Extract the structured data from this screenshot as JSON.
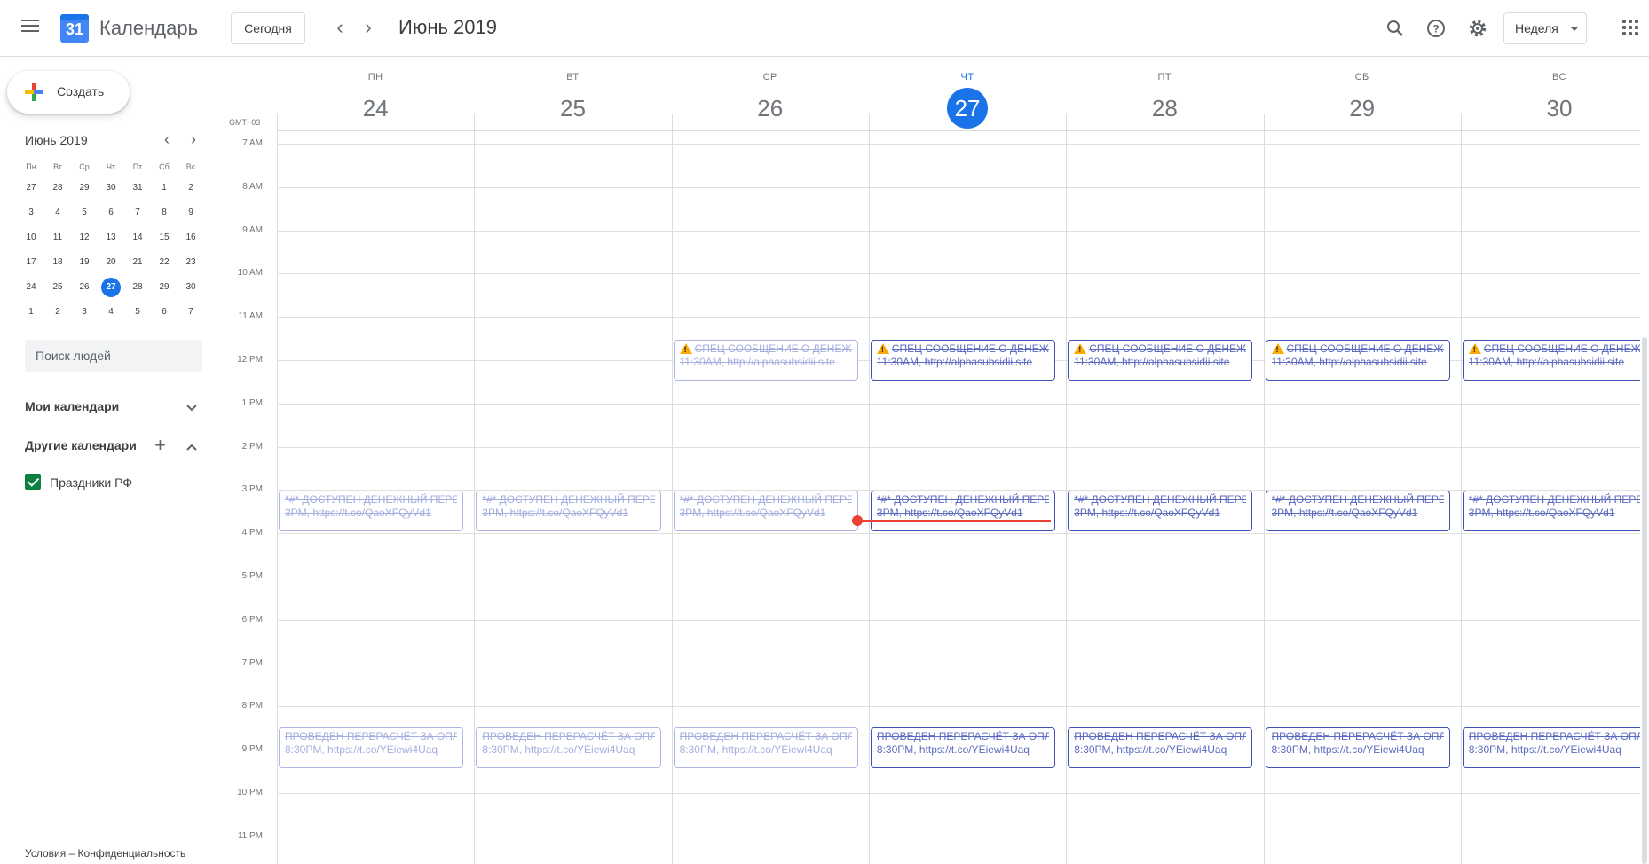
{
  "header": {
    "app_name": "Календарь",
    "logo_number": "31",
    "today_button": "Сегодня",
    "month_title": "Июнь 2019",
    "view_select": "Неделя",
    "icons": [
      "menu-icon",
      "chevron-left-icon",
      "chevron-right-icon",
      "search-icon",
      "help-icon",
      "settings-icon",
      "apps-icon"
    ]
  },
  "sidebar": {
    "create_label": "Создать",
    "mini_calendar": {
      "title": "Июнь 2019",
      "weekdays": [
        "Пн",
        "Вт",
        "Ср",
        "Чт",
        "Пт",
        "Сб",
        "Вс"
      ],
      "weeks": [
        [
          "27",
          "28",
          "29",
          "30",
          "31",
          "1",
          "2"
        ],
        [
          "3",
          "4",
          "5",
          "6",
          "7",
          "8",
          "9"
        ],
        [
          "10",
          "11",
          "12",
          "13",
          "14",
          "15",
          "16"
        ],
        [
          "17",
          "18",
          "19",
          "20",
          "21",
          "22",
          "23"
        ],
        [
          "24",
          "25",
          "26",
          "27",
          "28",
          "29",
          "30"
        ],
        [
          "1",
          "2",
          "3",
          "4",
          "5",
          "6",
          "7"
        ]
      ],
      "today": "27"
    },
    "people_search_placeholder": "Поиск людей",
    "my_calendars": "Мои календари",
    "other_calendars": "Другие календари",
    "calendar_items": [
      {
        "label": "Праздники РФ",
        "checked": true,
        "color": "#0b8043"
      }
    ],
    "footer": "Условия – Конфиденциальность"
  },
  "week": {
    "timezone": "GMT+03",
    "days": [
      {
        "dow": "ПН",
        "num": "24",
        "today": false
      },
      {
        "dow": "ВТ",
        "num": "25",
        "today": false
      },
      {
        "dow": "СР",
        "num": "26",
        "today": false
      },
      {
        "dow": "ЧТ",
        "num": "27",
        "today": true
      },
      {
        "dow": "ПТ",
        "num": "28",
        "today": false
      },
      {
        "dow": "СБ",
        "num": "29",
        "today": false
      },
      {
        "dow": "ВС",
        "num": "30",
        "today": false
      }
    ],
    "hours": [
      "7 AM",
      "8 AM",
      "9 AM",
      "10 AM",
      "11 AM",
      "12 PM",
      "1 PM",
      "2 PM",
      "3 PM",
      "4 PM",
      "5 PM",
      "6 PM",
      "7 PM",
      "8 PM",
      "9 PM",
      "10 PM",
      "11 PM"
    ],
    "event_types": [
      {
        "title": "СПЕЦ СООБЩЕНИЕ О ДЕНЕЖНОМ",
        "detail": "11:30AM, http://alphasubsidii.site",
        "warning": true,
        "days": [
          2,
          3,
          4,
          5,
          6
        ]
      },
      {
        "title": "*#* ДОСТУПЕН ДЕНЕЖНЫЙ ПЕРЕВОД",
        "detail": "3PM, https://t.co/QaoXFQyVd1",
        "warning": false,
        "days": [
          0,
          1,
          2,
          3,
          4,
          5,
          6
        ]
      },
      {
        "title": "ПРОВЕДЕН ПЕРЕРАСЧЁТ ЗА ОПЛАТУ",
        "detail": "8:30PM, https://t.co/YEiewi4Uaq",
        "warning": false,
        "days": [
          0,
          1,
          2,
          3,
          4,
          5,
          6
        ]
      }
    ],
    "colors": {
      "accent": "#1a73e8",
      "event_border": "#3f51b5",
      "past_event": "#a4aedf",
      "now_line": "#ea4335",
      "holiday": "#0b8043"
    }
  }
}
